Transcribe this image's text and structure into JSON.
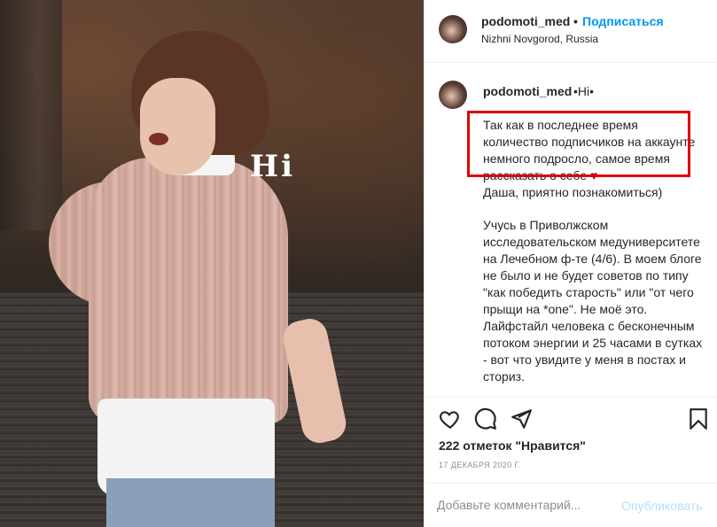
{
  "post": {
    "image_text": "Hi"
  },
  "header": {
    "username": "podomoti_med",
    "separator": "•",
    "follow_label": "Подписаться",
    "location": "Nizhni Novgorod, Russia"
  },
  "caption": {
    "username": "podomoti_med",
    "tag": "•Hi•",
    "paragraph1": "Так как в последнее время количество подписчиков на аккаунте немного подросло, самое время рассказать о себе",
    "heart": "♥",
    "paragraph1b": "Даша, приятно познакомиться)",
    "paragraph2": "Учусь в Приволжском исследовательском медуниверситете на Лечебном ф-те (4/6). В моем блоге не было и не будет советов по типу \"как победить старость\" или \"от чего прыщи на *one\". Не моё это. Лайфстайл человека с бесконечным потоком энергии и 25 часами в сутках - вот что увидите у меня в постах и сториз."
  },
  "actions": {
    "icons": [
      "heart-icon",
      "comment-icon",
      "share-icon",
      "bookmark-icon"
    ]
  },
  "likes_text": "222 отметок \"Нравится\"",
  "date": "17 ДЕКАБРЯ 2020 Г.",
  "comment": {
    "placeholder": "Добавьте комментарий...",
    "publish_label": "Опубликовать"
  },
  "colors": {
    "accent": "#0095f6",
    "highlight": "#e00000",
    "publish_disabled": "#b2dffc"
  }
}
